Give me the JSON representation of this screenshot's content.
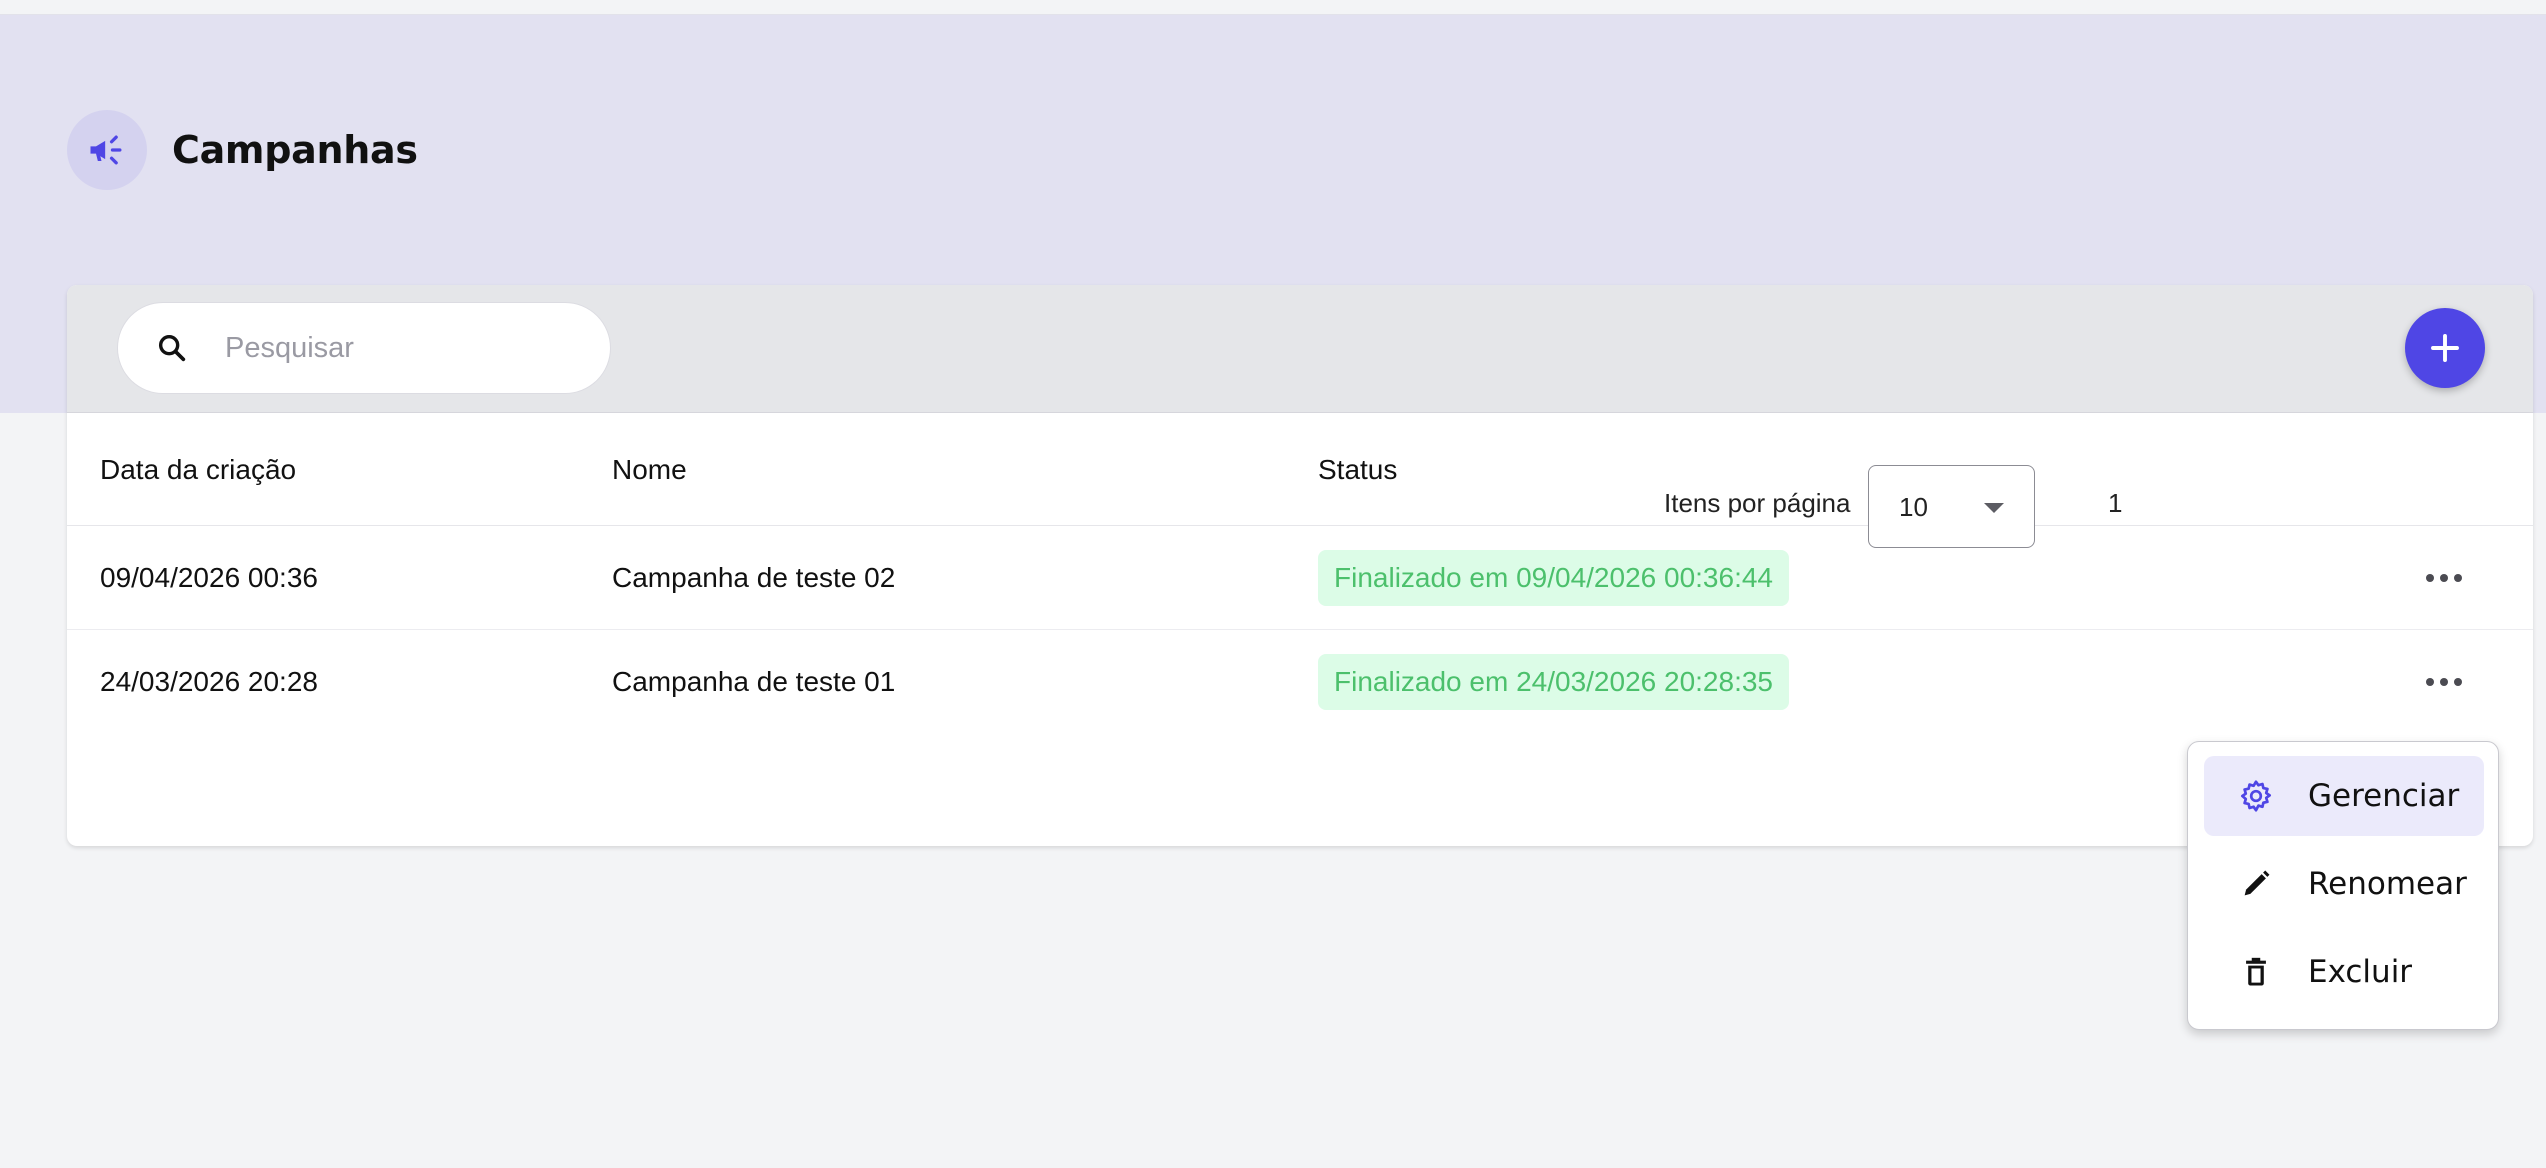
{
  "header": {
    "title": "Campanhas",
    "icon": "megaphone-icon"
  },
  "toolbar": {
    "search_placeholder": "Pesquisar",
    "search_value": "",
    "add_button_icon": "plus-icon"
  },
  "table": {
    "columns": [
      "Data da criação",
      "Nome",
      "Status"
    ],
    "rows": [
      {
        "created": "09/04/2026 00:36",
        "name": "Campanha de teste 02",
        "status": "Finalizado em 09/04/2026 00:36:44"
      },
      {
        "created": "24/03/2026 20:28",
        "name": "Campanha de teste 01",
        "status": "Finalizado em 24/03/2026 20:28:35"
      }
    ]
  },
  "pagination": {
    "items_per_page_label": "Itens por página",
    "page_size": "10",
    "range_text": "1"
  },
  "context_menu": {
    "items": [
      {
        "label": "Gerenciar",
        "icon": "gear-icon"
      },
      {
        "label": "Renomear",
        "icon": "pencil-icon"
      },
      {
        "label": "Excluir",
        "icon": "trash-icon"
      }
    ]
  },
  "colors": {
    "accent": "#4f46e5",
    "hero_bg": "#e2e1f1",
    "status_bg": "#dcfce7",
    "status_text": "#4cc06c"
  }
}
